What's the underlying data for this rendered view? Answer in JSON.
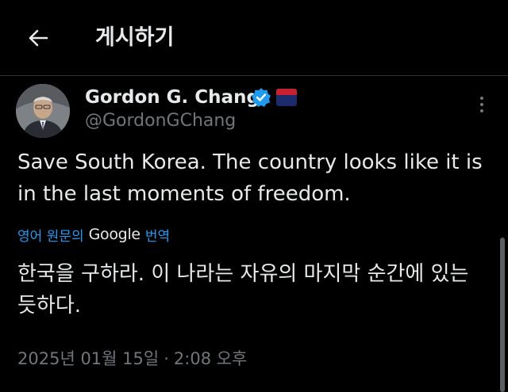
{
  "header": {
    "title": "게시하기"
  },
  "author": {
    "name": "Gordon G. Chang",
    "handle": "@GordonGChang",
    "verified": true,
    "affiliate_badge": "flag-badge"
  },
  "tweet": {
    "text": "Save South Korea. The country looks like it is in the last moments of freedom.",
    "translation_label_prefix": "영어 원문의",
    "translation_provider": "Google",
    "translation_label_suffix": "번역",
    "translated_text": "한국을 구하라. 이 나라는 자유의 마지막 순간에 있는 듯하다.",
    "date": "2025년 01월 15일",
    "separator": "·",
    "time": "2:08 오후"
  },
  "colors": {
    "background": "#000000",
    "text": "#e7e9ea",
    "secondary": "#71767b",
    "link": "#1d9bf0"
  }
}
